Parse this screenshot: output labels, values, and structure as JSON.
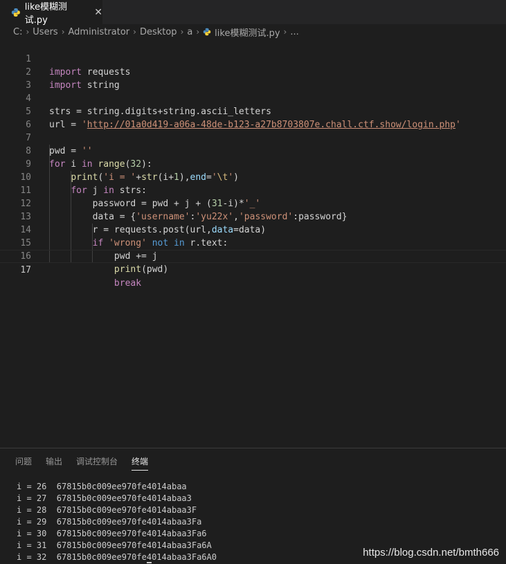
{
  "tab": {
    "filename": "like模糊测试.py"
  },
  "breadcrumb": [
    "C:",
    "Users",
    "Administrator",
    "Desktop",
    "a",
    "like模糊测试.py",
    "..."
  ],
  "code": {
    "url": "http://01a0d419-a06a-48de-b123-a27b8703807e.chall.ctf.show/login.php",
    "line_numbers": [
      "1",
      "2",
      "3",
      "4",
      "5",
      "6",
      "7",
      "8",
      "9",
      "10",
      "11",
      "12",
      "13",
      "14",
      "15",
      "16",
      "17"
    ]
  },
  "panel": {
    "tabs": [
      "问题",
      "输出",
      "调试控制台",
      "终端"
    ],
    "active_tab": "终端"
  },
  "terminal": [
    "i = 26  67815b0c009ee970fe4014abaa",
    "i = 27  67815b0c009ee970fe4014abaa3",
    "i = 28  67815b0c009ee970fe4014abaa3F",
    "i = 29  67815b0c009ee970fe4014abaa3Fa",
    "i = 30  67815b0c009ee970fe4014abaa3Fa6",
    "i = 31  67815b0c009ee970fe4014abaa3Fa6A",
    "i = 32  67815b0c009ee970fe4014abaa3Fa6A0"
  ],
  "watermark": "https://blog.csdn.net/bmth666",
  "colors": {
    "keyword": "#569cd6",
    "control": "#c586c0",
    "function": "#dcdcaa",
    "string": "#ce9178",
    "number": "#b5cea8",
    "param": "#9cdcfe"
  },
  "icons": {
    "tab": "python-icon",
    "close": "close-icon",
    "breadcrumb_file": "python-icon"
  }
}
